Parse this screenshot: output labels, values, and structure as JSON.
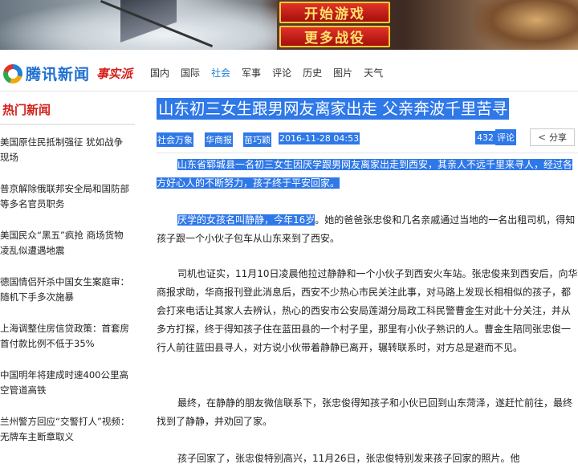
{
  "banner": {
    "start_button": "开始游戏",
    "more_button": "更多战役"
  },
  "header": {
    "logo_text": "腾讯新闻",
    "logo_sub": "事实派",
    "nav": [
      "国内",
      "国际",
      "社会",
      "军事",
      "评论",
      "历史",
      "图片",
      "天气"
    ],
    "active_nav": "社会"
  },
  "sidebar": {
    "title": "热门新闻",
    "items": [
      "美国原住民抵制强征 犹如战争现场",
      "普京解除俄联邦安全局和国防部等多名官员职务",
      "美国民众“黑五”疯抢 商场货物凌乱似遭遇地震",
      "德国情侣歼杀中国女生案庭审：随机下手多次施暴",
      "上海调整住房信贷政策：首套房首付款比例不低于35%",
      "中国明年将建成时速400公里高空管道高铁",
      "兰州警方回应“交警打人”视频：无牌车主断章取义"
    ]
  },
  "article": {
    "title": "山东初三女生跟男网友离家出走 父亲奔波千里苦寻",
    "tag": "社会万象",
    "source": "华商报",
    "author": "苗巧颖",
    "datetime": "2016-11-28 04:53",
    "comment_count": "432",
    "comment_label": "评论",
    "share_label": "分享",
    "p1": "山东省郓城县一名初三女生因厌学跟男网友离家出走到西安，其亲人不远千里来寻人，经过各方好心人的不断努力，孩子终于平安回家。",
    "p2_hl": "厌学的女孩名叫静静，今年16岁",
    "p2_rest": "。她的爸爸张忠俊和几名亲戚通过当地的一名出租司机，得知孩子跟一个小伙子包车从山东来到了西安。",
    "p3": "司机也证实，11月10日凌晨他拉过静静和一个小伙子到西安火车站。张忠俊来到西安后，向华商报求助，华商报刊登此消息后，西安不少热心市民关注此事，对马路上发现长相相似的孩子，都会打来电话让其家人去辨认，热心的西安市公安局莲湖分局政工科民警曹金生对此十分关注，并从多方打探，终于得知孩子住在蓝田县的一个村子里，那里有小伙子熟识的人。曹金生陪同张忠俊一行人前往蓝田县寻人，对方说小伙带着静静已离开，辗转联系时，对方总是避而不见。",
    "p4": "最终，在静静的朋友微信联系下，张忠俊得知孩子和小伙已回到山东菏泽，遂赶忙前往，最终找到了静静，并劝回了家。",
    "p5": "孩子回家了，张忠俊特别高兴，11月26日，张忠俊特别发来孩子回家的照片。他"
  }
}
